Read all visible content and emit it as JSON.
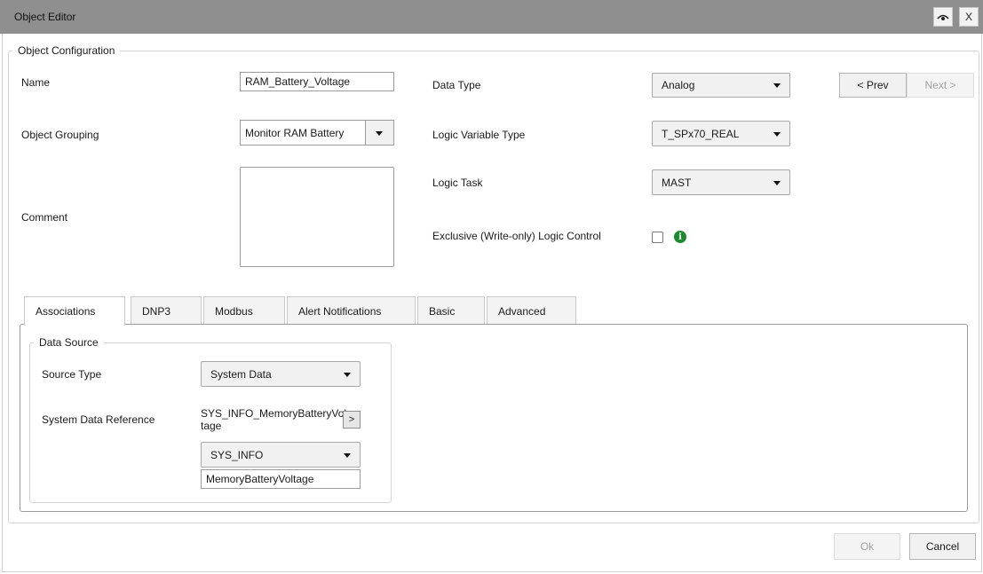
{
  "window": {
    "title": "Object Editor",
    "close_label": "X"
  },
  "object_configuration": {
    "legend": "Object Configuration",
    "name_label": "Name",
    "name_value": "RAM_Battery_Voltage",
    "grouping_label": "Object Grouping",
    "grouping_value": "Monitor RAM Battery",
    "comment_label": "Comment",
    "comment_value": "",
    "data_type_label": "Data Type",
    "data_type_value": "Analog",
    "logic_variable_type_label": "Logic Variable Type",
    "logic_variable_type_value": "T_SPx70_REAL",
    "logic_task_label": "Logic Task",
    "logic_task_value": "MAST",
    "exclusive_label": "Exclusive (Write-only) Logic Control",
    "exclusive_checked": false,
    "prev_label": "< Prev",
    "next_label": "Next >"
  },
  "tabs": [
    {
      "label": "Associations",
      "active": true
    },
    {
      "label": "DNP3",
      "active": false
    },
    {
      "label": "Modbus",
      "active": false
    },
    {
      "label": "Alert Notifications",
      "active": false
    },
    {
      "label": "Basic",
      "active": false
    },
    {
      "label": "Advanced",
      "active": false
    }
  ],
  "data_source": {
    "legend": "Data Source",
    "source_type_label": "Source Type",
    "source_type_value": "System Data",
    "reference_label": "System Data Reference",
    "reference_text_line1": "SYS_INFO_MemoryBatteryVol",
    "reference_text_line2": "tage",
    "reference_button_label": ">",
    "reference_group_value": "SYS_INFO",
    "reference_item_value": "MemoryBatteryVoltage"
  },
  "footer": {
    "ok_label": "Ok",
    "cancel_label": "Cancel"
  },
  "icons": {
    "visibility": "eye-icon",
    "info": "info-icon",
    "dropdown": "chevron-down-icon"
  },
  "colors": {
    "title_bar": "#8f8f8f",
    "info_icon": "#1c8a2e"
  }
}
